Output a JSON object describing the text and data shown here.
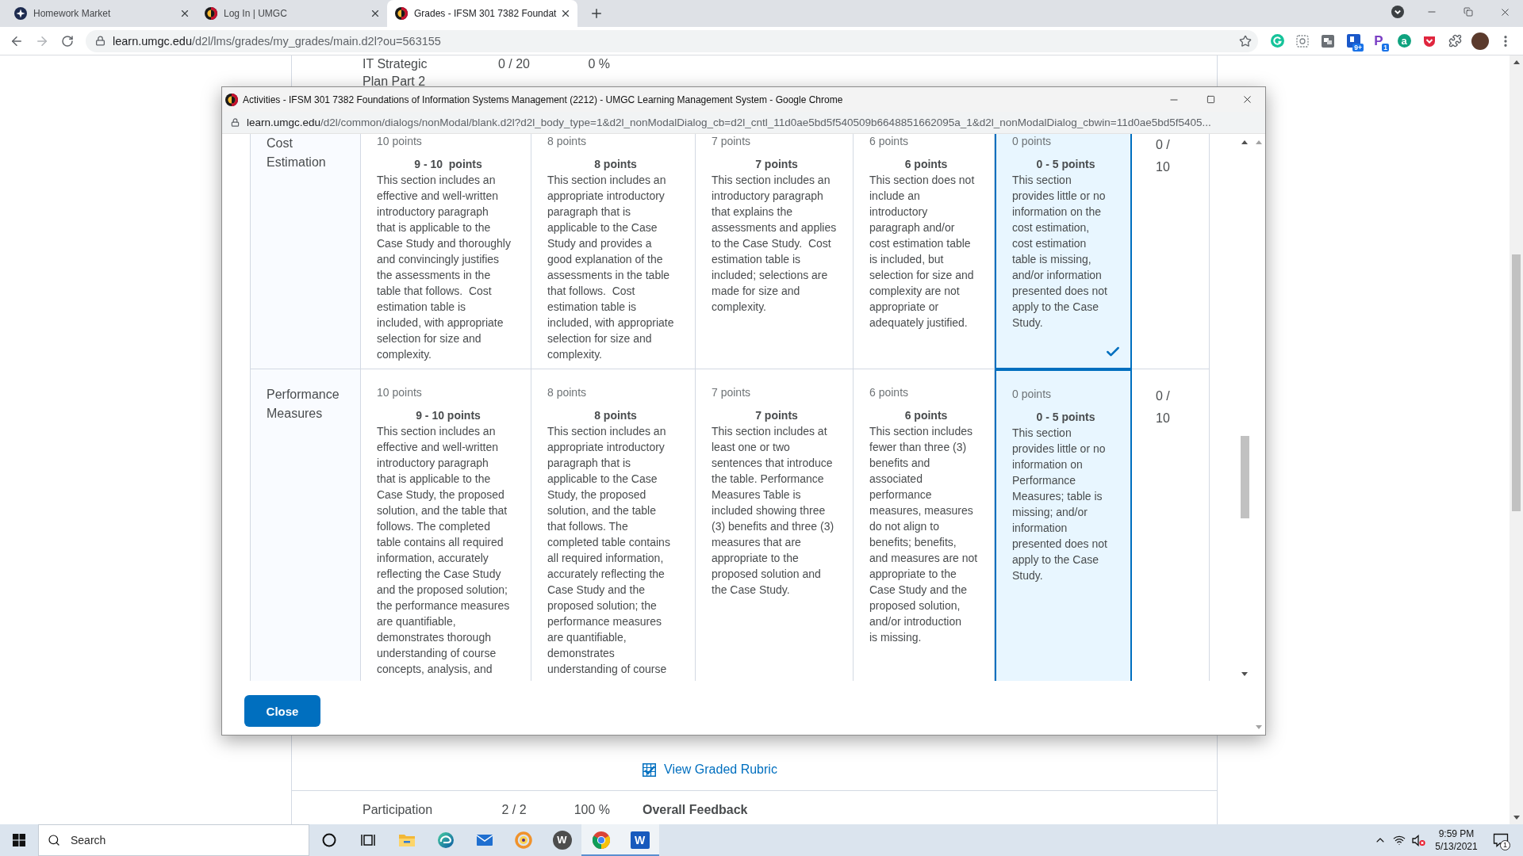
{
  "browser": {
    "tabs": [
      {
        "kind": "star",
        "title": "Homework Market",
        "selected": false
      },
      {
        "kind": "ring",
        "title": "Log In | UMGC",
        "selected": false
      },
      {
        "kind": "ring",
        "title": "Grades - IFSM 301 7382 Foundat",
        "selected": true
      }
    ],
    "url_host": "learn.umgc.edu",
    "url_path": "/d2l/lms/grades/my_grades/main.d2l?ou=563155",
    "extensions": [
      {
        "kind": "ring"
      },
      {
        "kind": "dashed"
      },
      {
        "kind": "image"
      },
      {
        "kind": "tile",
        "badge": "9+"
      },
      {
        "kind": "letter",
        "letter": "P",
        "badge": "1"
      },
      {
        "kind": "disc",
        "letter": "a"
      },
      {
        "kind": "shield"
      },
      {
        "kind": "puzzle"
      }
    ]
  },
  "page": {
    "top_row": {
      "item": "IT Strategic Plan Part 2",
      "points": "0 / 20",
      "weight": "0 %"
    },
    "rubric_link": "View Graded Rubric",
    "bottom_row": {
      "item": "Participation",
      "points": "2 / 2",
      "weight": "100 %",
      "feedback": "Overall Feedback"
    }
  },
  "popup": {
    "title": "Activities - IFSM 301 7382 Foundations of Information Systems Management (2212) - UMGC Learning Management System - Google Chrome",
    "url_host": "learn.umgc.edu",
    "url_path": "/d2l/common/dialogs/nonModal/blank.d2l?d2l_body_type=1&d2l_nonModalDialog_cb=d2l_cntl_11d0ae5bd5f540509b6648851662095a_1&d2l_nonModalDialog_cbwin=11d0ae5bd5f5405...",
    "rubric": {
      "rows": [
        {
          "criterion": "Cost Estimation",
          "score": "0 / 10",
          "levels": [
            {
              "points": "10 points",
              "range": "9 - 10  points",
              "description": [
                "This section includes an",
                "effective and well-written",
                "introductory paragraph",
                "that is applicable to the",
                "Case Study and thoroughly",
                "and convincingly justifies",
                "the assessments in the",
                "table that follows.  Cost",
                "estimation table is",
                "included, with appropriate",
                "selection for size and",
                "complexity."
              ],
              "selected": false,
              "checked": false
            },
            {
              "points": "8 points",
              "range": "8 points",
              "description": [
                "This section includes an",
                "appropriate introductory",
                "paragraph that is",
                "applicable to the Case",
                "Study and provides a",
                "good explanation of the",
                "assessments in the table",
                "that follows.  Cost",
                "estimation table is",
                "included, with appropriate",
                "selection for size and",
                "complexity."
              ],
              "selected": false,
              "checked": false
            },
            {
              "points": "7 points",
              "range": "7 points",
              "description": [
                "This section includes an",
                "introductory paragraph",
                "that explains the",
                "assessments and applies",
                "to the Case Study.  Cost",
                "estimation table is",
                "included; selections are",
                "made for size and",
                "complexity."
              ],
              "selected": false,
              "checked": false
            },
            {
              "points": "6 points",
              "range": "6 points",
              "description": [
                "This section does not",
                "include an",
                "introductory",
                "paragraph and/or",
                "cost estimation table",
                "is included, but",
                "selection for size and",
                "complexity are not",
                "appropriate or",
                "adequately justified."
              ],
              "selected": false,
              "checked": false
            },
            {
              "points": "0 points",
              "range": "0 - 5 points",
              "description": [
                "This section",
                "provides little or no",
                "information on the",
                "cost estimation,",
                "cost estimation",
                "table is missing,",
                "and/or information",
                "presented does not",
                "apply to the Case",
                "Study."
              ],
              "selected": true,
              "checked": true
            }
          ]
        },
        {
          "criterion": "Performance Measures",
          "score": "0 / 10",
          "levels": [
            {
              "points": "10 points",
              "range": "9 - 10 points",
              "description": [
                "This section includes an",
                "effective and well-written",
                "introductory paragraph",
                "that is applicable to the",
                "Case Study, the proposed",
                "solution, and the table that",
                "follows. The completed",
                "table contains all required",
                "information, accurately",
                "reflecting the Case Study",
                "and the proposed solution;",
                "the performance measures",
                "are quantifiable,",
                "demonstrates thorough",
                "understanding of course",
                "concepts, analysis, and"
              ],
              "selected": false,
              "checked": false
            },
            {
              "points": "8 points",
              "range": "8 points",
              "description": [
                "This section includes an",
                "appropriate introductory",
                "paragraph that is",
                "applicable to the Case",
                "Study, the proposed",
                "solution, and the table",
                "that follows. The",
                "completed table contains",
                "all required information,",
                "accurately reflecting the",
                "Case Study and the",
                "proposed solution; the",
                "performance measures",
                "are quantifiable,",
                "demonstrates",
                "understanding of course"
              ],
              "selected": false,
              "checked": false
            },
            {
              "points": "7 points",
              "range": "7 points",
              "description": [
                "This section includes at",
                "least one or two",
                "sentences that introduce",
                "the table. Performance",
                "Measures Table is",
                "included showing three",
                "(3) benefits and three (3)",
                "measures that are",
                "appropriate to the",
                "proposed solution and",
                "the Case Study."
              ],
              "selected": false,
              "checked": false
            },
            {
              "points": "6 points",
              "range": "6 points",
              "description": [
                "This section includes",
                "fewer than three (3)",
                "benefits and",
                "associated",
                "performance",
                "measures, measures",
                "do not align to",
                "benefits; benefits,",
                "and measures are not",
                "appropriate to the",
                "Case Study and the",
                "proposed solution,",
                "and/or introduction",
                "is missing."
              ],
              "selected": false,
              "checked": false
            },
            {
              "points": "0 points",
              "range": "0 - 5 points",
              "description": [
                "This section",
                "provides little or no",
                "information on",
                "Performance",
                "Measures; table is",
                "missing; and/or",
                "information",
                "presented does not",
                "apply to the Case",
                "Study."
              ],
              "selected": true,
              "checked": false
            }
          ]
        }
      ]
    },
    "close_button": "Close"
  },
  "taskbar": {
    "search": {
      "placeholder": "Search"
    },
    "buttons": [
      {
        "kind": "cortana",
        "open": false
      },
      {
        "kind": "task_view",
        "open": false
      },
      {
        "kind": "folder",
        "open": false
      },
      {
        "kind": "edge",
        "open": false
      },
      {
        "kind": "mail",
        "open": false
      },
      {
        "kind": "ring",
        "open": false
      },
      {
        "kind": "letter",
        "letter": "W",
        "open": false
      },
      {
        "kind": "chrome",
        "open": true
      },
      {
        "kind": "word",
        "letter": "W",
        "open": true
      }
    ],
    "time": "9:59 PM",
    "date": "5/13/2021",
    "notifications": "1"
  }
}
